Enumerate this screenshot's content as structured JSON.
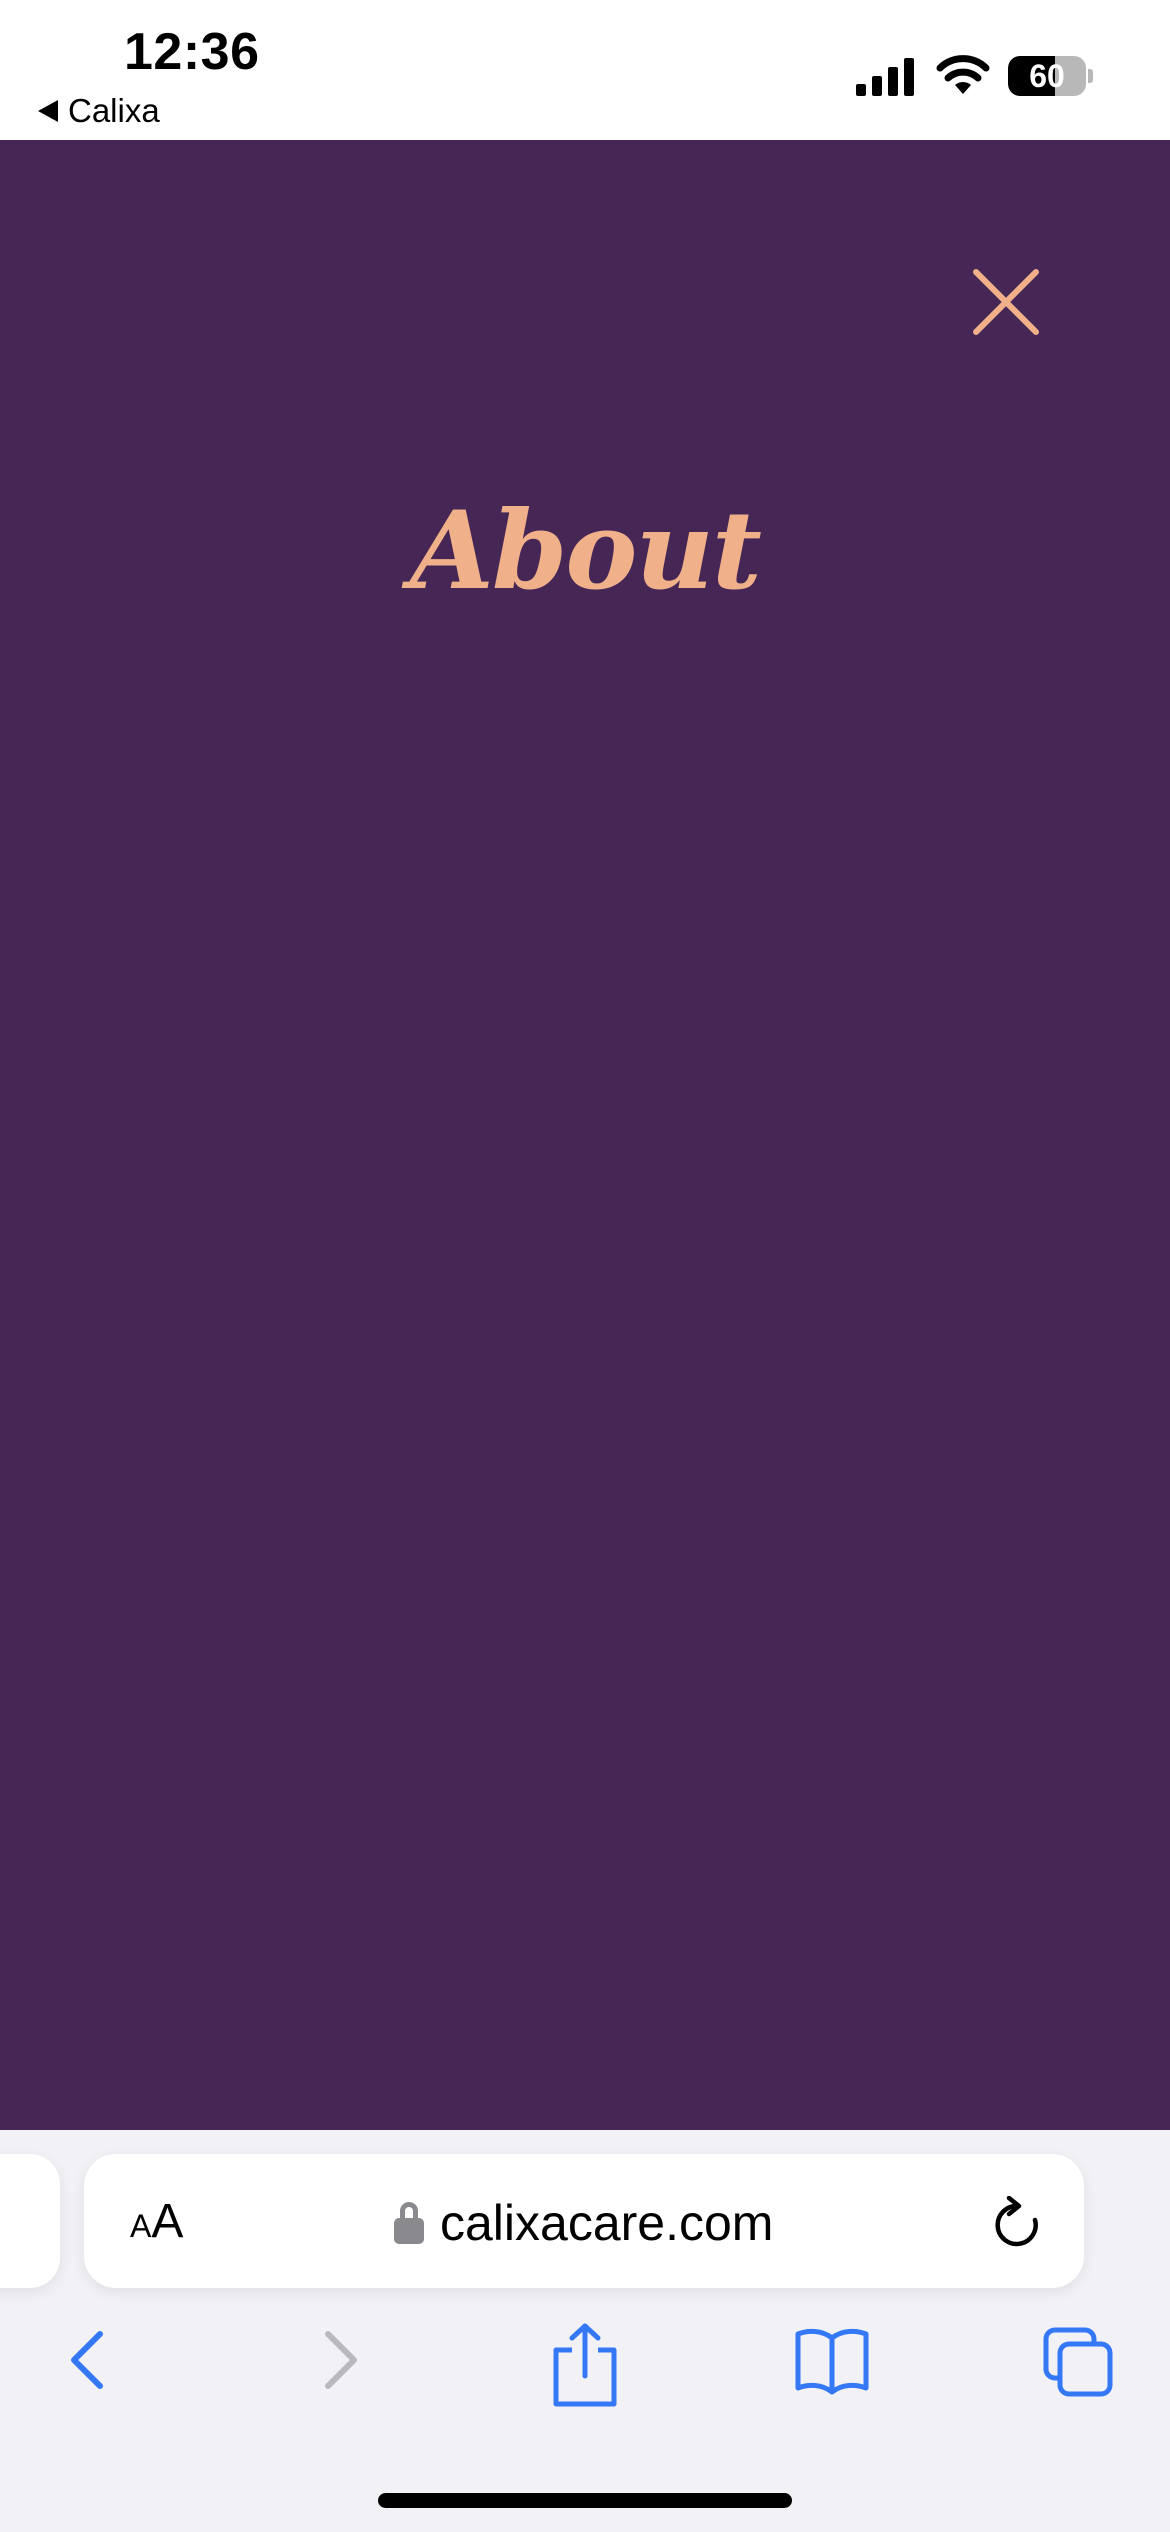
{
  "status_bar": {
    "time": "12:36",
    "back_app_label": "Calixa",
    "battery_level": "60",
    "battery_fraction": 0.6
  },
  "page": {
    "title": "About",
    "background_color": "#452655",
    "accent_color": "#f0b08a",
    "close_icon": "close-icon"
  },
  "safari": {
    "text_size_small": "A",
    "text_size_large": "A",
    "url": "calixacare.com",
    "icons": {
      "lock": "lock-icon",
      "reload": "reload-icon",
      "back": "chevron-left-icon",
      "forward": "chevron-right-icon",
      "share": "share-icon",
      "bookmarks": "book-icon",
      "tabs": "tabs-icon"
    },
    "toolbar_color": "#3478f6"
  }
}
